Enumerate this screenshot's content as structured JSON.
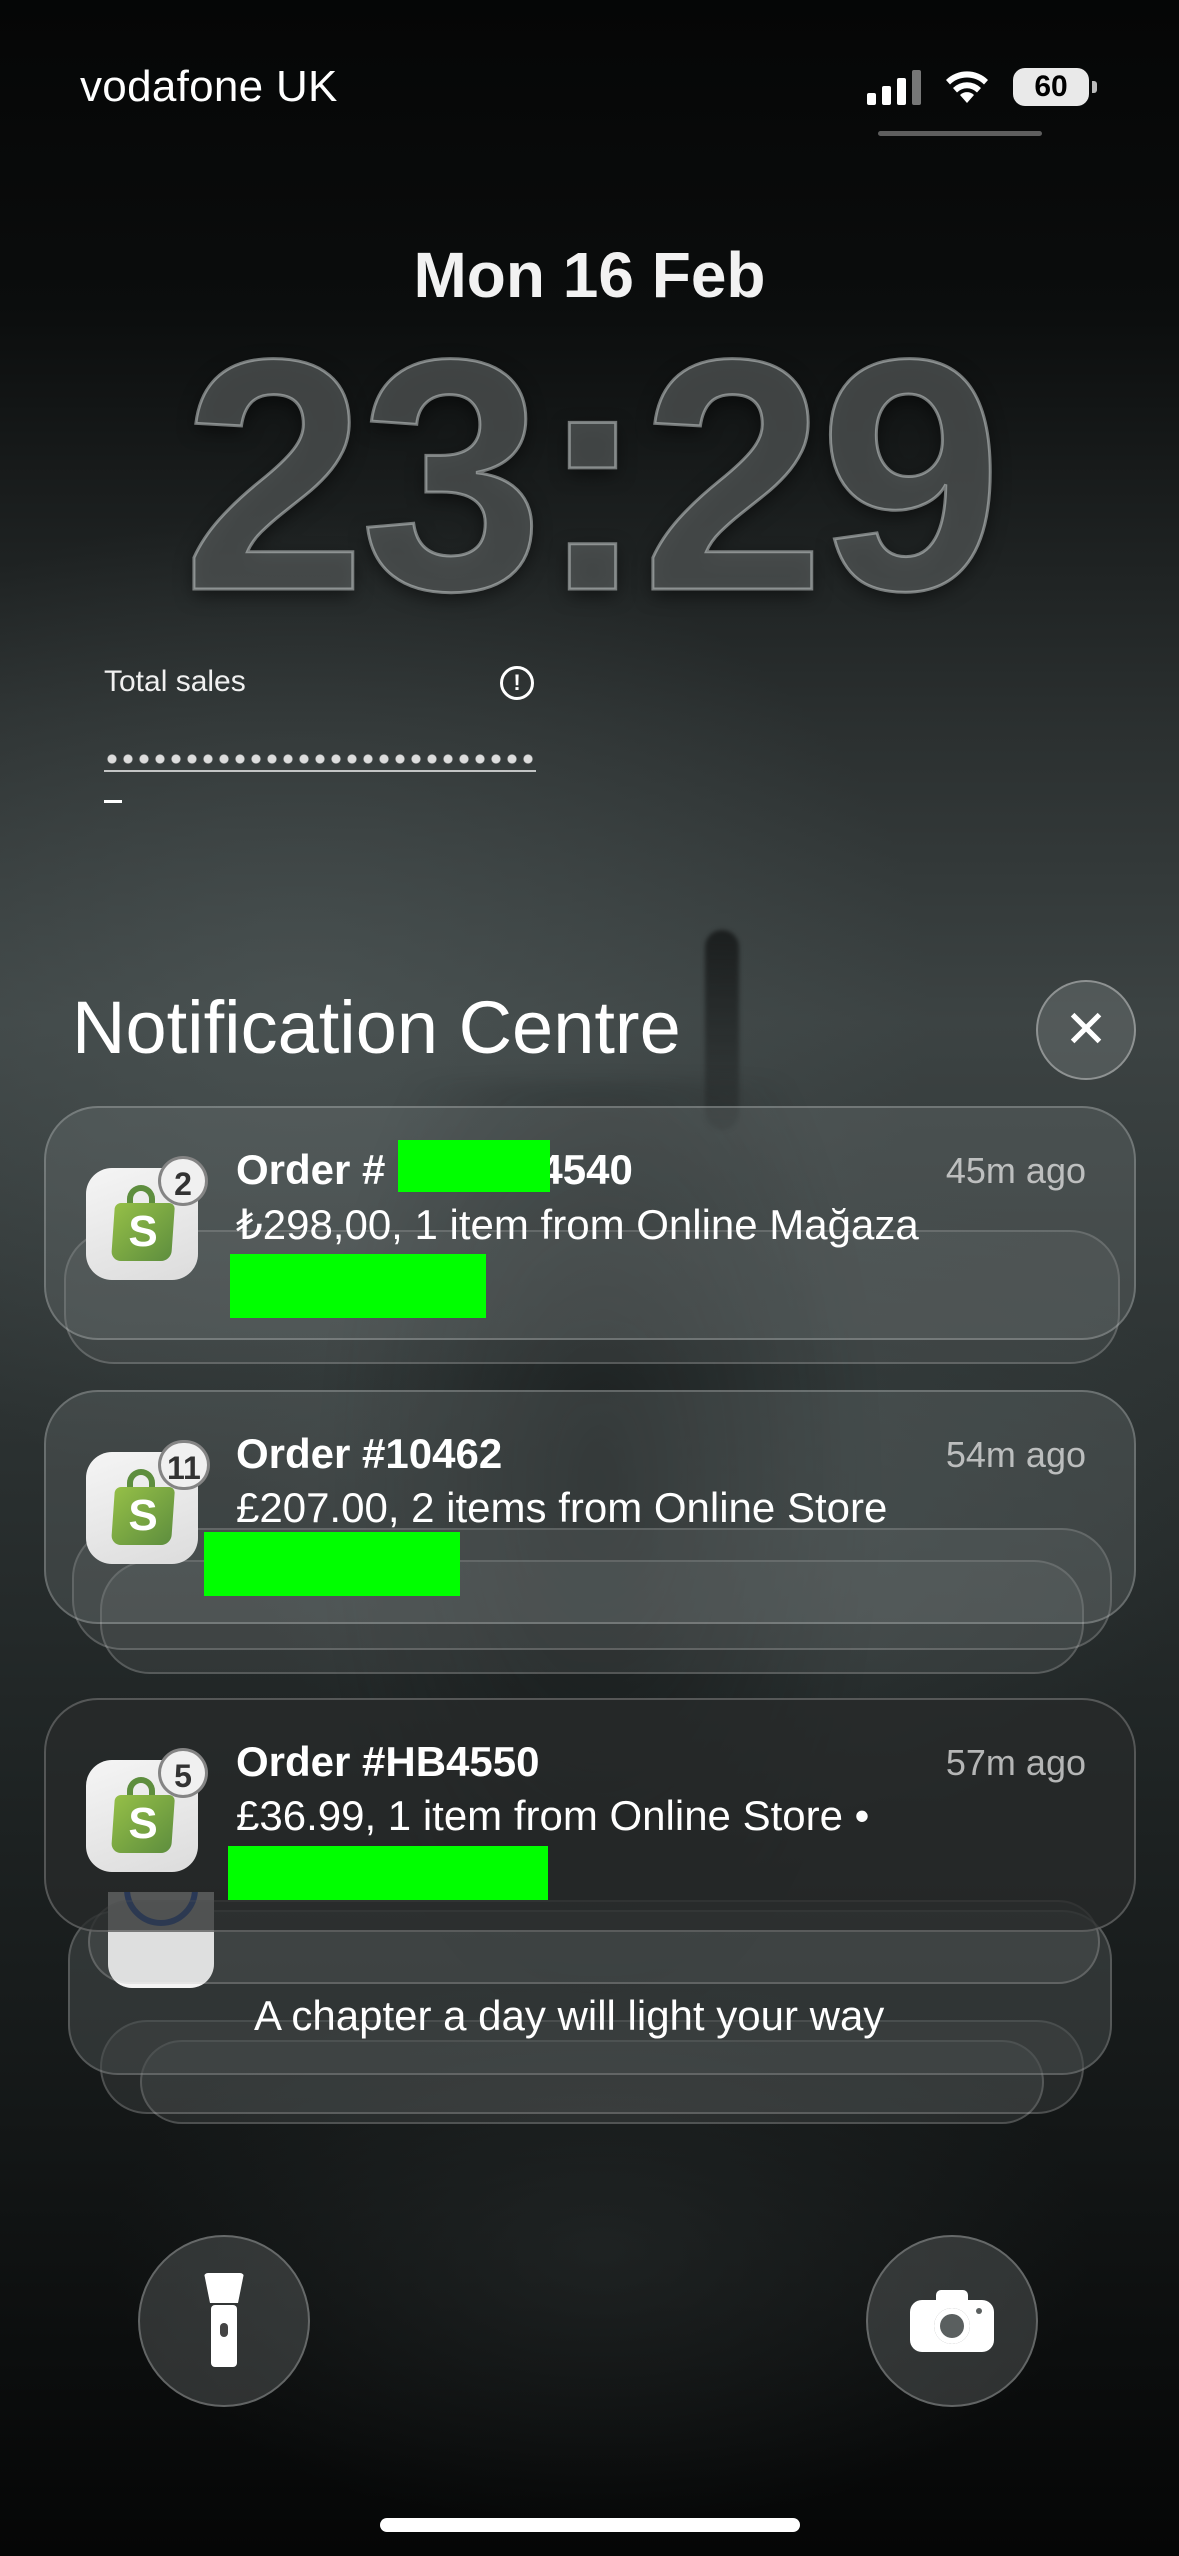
{
  "status_bar": {
    "carrier": "vodafone UK",
    "battery": "60",
    "signal_icon": "cellular-signal-icon",
    "wifi_icon": "wifi-icon"
  },
  "lock_screen": {
    "date": "Mon 16 Feb",
    "time": "23:29"
  },
  "widget": {
    "label": "Total sales",
    "info_icon": "info-icon",
    "value_placeholder": "–"
  },
  "notification_centre": {
    "title": "Notification Centre",
    "close_icon": "close-icon",
    "notifications": [
      {
        "app": "Shopify",
        "badge": "2",
        "title_prefix": "Order #",
        "title_suffix": "4540",
        "time": "45m ago",
        "body": "₺298,00, 1 item from Online Mağaza"
      },
      {
        "app": "Shopify",
        "badge": "11",
        "title": "Order #10462",
        "time": "54m ago",
        "body": "£207.00, 2 items from Online Store"
      },
      {
        "app": "Shopify",
        "badge": "5",
        "title": "Order #HB4550",
        "time": "57m ago",
        "body": "£36.99, 1 item from Online Store •"
      },
      {
        "app": "Bible",
        "body": "A chapter a day will light your way"
      }
    ]
  },
  "quick_actions": {
    "torch_icon": "flashlight-icon",
    "camera_icon": "camera-icon"
  },
  "colors": {
    "redaction": "#00ff00",
    "shopify_green": "#95bf47"
  }
}
